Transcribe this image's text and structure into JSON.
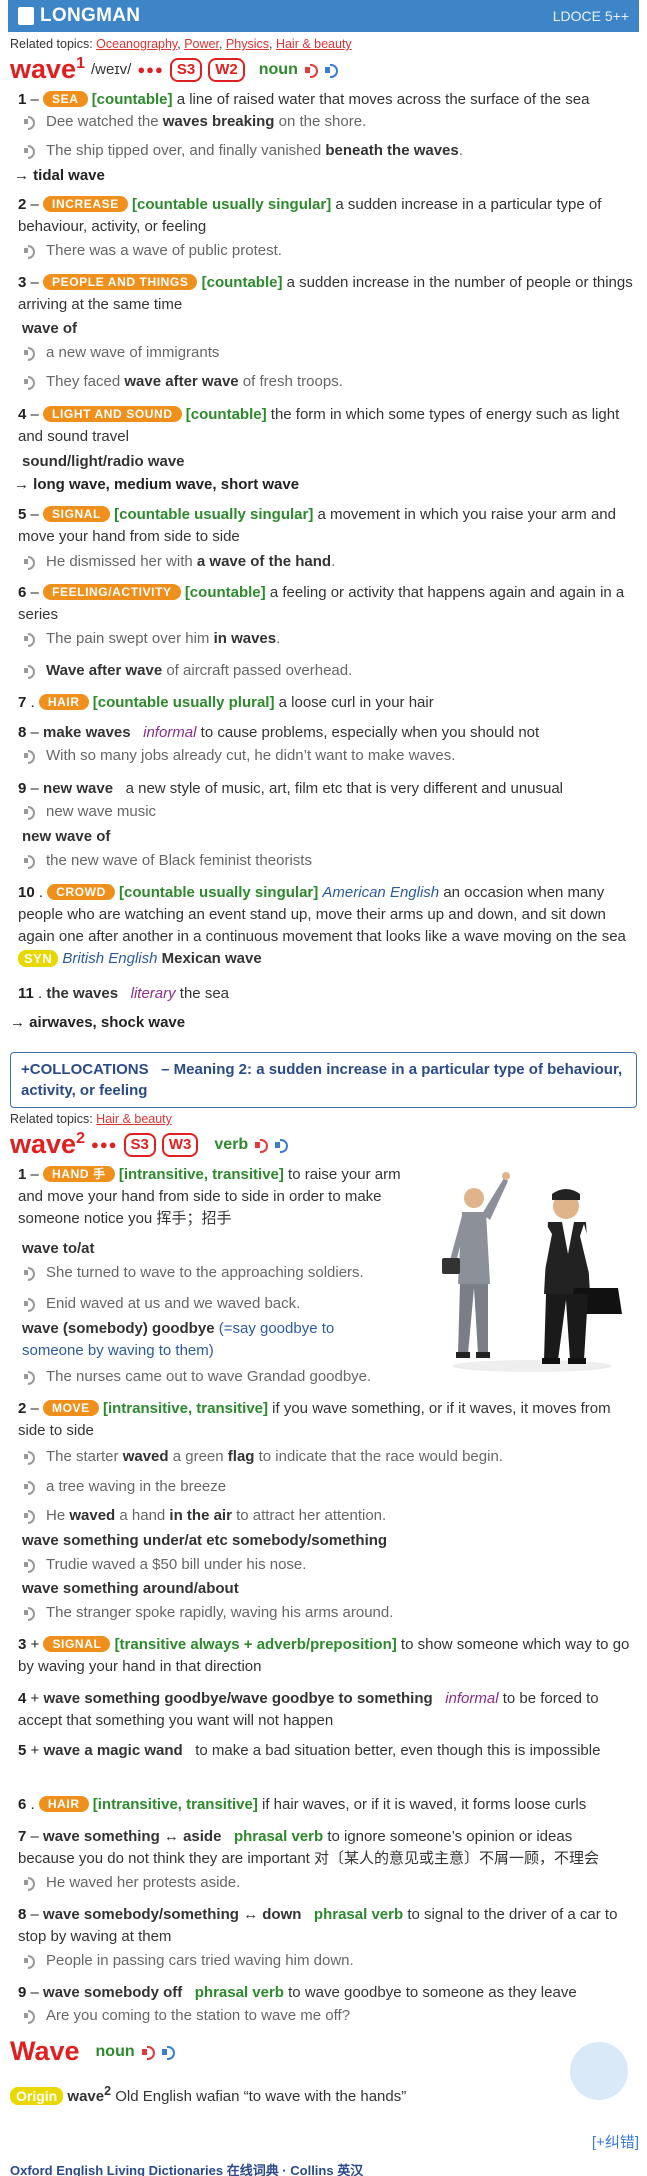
{
  "header": {
    "title": "LONGMAN",
    "edition": "LDOCE 5++"
  },
  "entry1": {
    "topics_label": "Related topics:",
    "topics": [
      "Oceanography",
      "Power",
      "Physics",
      "Hair & beauty"
    ],
    "word": "wave",
    "hom": "1",
    "pron": "/weɪv/",
    "dots": "●●●",
    "s": "S3",
    "w": "W2",
    "pos": "noun",
    "senses": [
      {
        "num": "1",
        "signpost": "SEA",
        "gram": "[countable]",
        "def": "a line of raised water that moves across the surface of the sea"
      },
      {
        "num": "2",
        "signpost": "INCREASE",
        "gram": "[countable usually singular]",
        "def": "a sudden increase in a particular type of behaviour, activity, or feeling"
      },
      {
        "num": "3",
        "signpost": "PEOPLE AND THINGS",
        "gram": "[countable]",
        "def": "a sudden increase in the number of people or things arriving at the same time"
      },
      {
        "num": "4",
        "signpost": "LIGHT AND SOUND",
        "gram": "[countable]",
        "def": "the form in which some types of energy such as light and sound travel"
      },
      {
        "num": "5",
        "signpost": "SIGNAL",
        "gram": "[countable usually singular]",
        "def": "a movement in which you raise your arm and move your hand from side to side"
      },
      {
        "num": "6",
        "signpost": "FEELING/ACTIVITY",
        "gram": "[countable]",
        "def": "a feeling or activity that happens again and again in a series"
      },
      {
        "num": "7",
        "signpost": "HAIR",
        "gram": "[countable usually plural]",
        "def": "a loose curl in your hair"
      },
      {
        "num": "8",
        "phrase": "make waves",
        "reg": "informal",
        "def": "to cause problems, especially when you should not"
      },
      {
        "num": "9",
        "phrase": "new wave",
        "def": "a new style of music, art, film etc that is very different and unusual"
      },
      {
        "num": "10",
        "signpost": "CROWD",
        "gram": "[countable usually singular]",
        "geo": "American English",
        "def": "an occasion when many people who are watching an event stand up, move their arms up and down, and sit down again one after another in a continuous movement that looks like a wave moving on the sea",
        "syn": "SYN",
        "syn_geo": "British English",
        "syn_word": "Mexican wave"
      },
      {
        "num": "11",
        "phrase": "the waves",
        "reg": "literary",
        "def": "the sea"
      }
    ],
    "examples": {
      "e1a": "Dee watched the ",
      "e1a_b": "waves breaking",
      " e1a_c": " on the shore.",
      "e1b": "The ship tipped over, and finally vanished ",
      "e1b_b": "beneath the waves",
      "ref1": "→ tidal wave",
      "e2": "There was a wave of public protest.",
      "p3": "wave of",
      "e3a": "a new wave of immigrants",
      "e3b": "They faced ",
      "e3b_b": "wave after wave",
      "e3b_c": " of fresh troops.",
      "p4": "sound/light/radio wave",
      "ref4": "→ long wave, medium wave, short wave",
      "e5": "He dismissed her with ",
      "e5_b": "a wave of the hand",
      "e6a": "The pain swept over him ",
      "e6a_b": "in waves",
      "e6b_b": "Wave after wave",
      "e6b": " of aircraft passed overhead.",
      "e8": "With so many jobs already cut, he didn’t want to make waves.",
      "e9a": "new wave music",
      "p9": "new wave of",
      "e9b": "the new wave of Black feminist theorists",
      "ref_end": "→ airwaves, shock wave"
    }
  },
  "collocations": {
    "plus": "+",
    "label": "COLLOCATIONS",
    "text": "– Meaning 2: a sudden increase in a particular type of behaviour, activity, or feeling"
  },
  "entry2": {
    "topics_label": "Related topics:",
    "topics": [
      "Hair & beauty"
    ],
    "word": "wave",
    "hom": "2",
    "dots": "●●●",
    "s": "S3",
    "w": "W3",
    "pos": "verb",
    "senses": [
      {
        "num": "1",
        "signpost": "HAND",
        "cn": "手",
        "gram": "[intransitive, transitive]",
        "def": "to raise your arm and move your hand from side to side in order to make someone notice you",
        "zh": "挥手；招手"
      },
      {
        "num": "2",
        "signpost": "MOVE",
        "gram": "[intransitive, transitive]",
        "def": "if you wave something, or if it waves, it moves from side to side"
      },
      {
        "num": "3",
        "signpost": "SIGNAL",
        "gram": "[transitive always + adverb/preposition]",
        "def": "to show someone which way to go by waving your hand in that direction"
      },
      {
        "num": "4",
        "phrase": "wave something goodbye/wave goodbye to something",
        "reg": "informal",
        "def": "to be forced to accept that something you want will not happen"
      },
      {
        "num": "5",
        "phrase": "wave a magic wand",
        "def": "to make a bad situation better, even though this is impossible"
      },
      {
        "num": "6",
        "signpost": "HAIR",
        "gram": "[intransitive, transitive]",
        "def": "if hair waves, or if it is waved, it forms loose curls"
      },
      {
        "num": "7",
        "phrase": "wave something ↔ aside",
        "pv": "phrasal verb",
        "def": "to ignore someone’s opinion or ideas because you do not think they are important 对〔某人的意见或主意〕不屑一顾，不理会"
      },
      {
        "num": "8",
        "phrase": "wave somebody/something ↔ down",
        "pv": "phrasal verb",
        "def": "to signal to the driver of a car to stop by waving at them"
      },
      {
        "num": "9",
        "phrase": "wave somebody off",
        "pv": "phrasal verb",
        "def": "to wave goodbye to someone as they leave"
      }
    ],
    "examples": {
      "p1a": "wave to/at",
      "e1a": "She turned to wave to the approaching soldiers.",
      "e1b": "Enid waved at us and we waved back.",
      "p1b": "wave (somebody) goodbye",
      "p1b_def": "(=say goodbye to someone by waving to them)",
      "e1c": "The nurses came out to wave Grandad goodbye.",
      "e2a": "The starter ",
      "e2a_b": "waved",
      "e2a_c": " a green ",
      "e2a_d": "flag",
      "e2a_e": " to indicate that the race would begin.",
      "e2b": "a tree waving in the breeze",
      "e2c": "He ",
      "e2c_b": "waved",
      "e2c_c": " a hand ",
      "e2c_d": "in the air",
      "e2c_e": " to attract her attention.",
      "p2a": "wave something under/at etc somebody/something",
      "e2d": "Trudie waved a $50 bill under his nose.",
      "p2b": "wave something around/about",
      "e2e": "The stranger spoke rapidly, waving his arms around.",
      "e7": "He waved her protests aside.",
      "e8": "People in passing cars tried waving him down.",
      "e9": "Are you coming to the station to wave me off?"
    }
  },
  "entry3": {
    "word": "Wave",
    "pos": "noun"
  },
  "origin": {
    "label": "Origin",
    "word": "wave",
    "hom": "2",
    "text": "Old English wafian “to wave with the hands”"
  },
  "correction": "[+纠错]",
  "footer": "Oxford English Living Dictionaries 在线词典 · Collins 英汉"
}
